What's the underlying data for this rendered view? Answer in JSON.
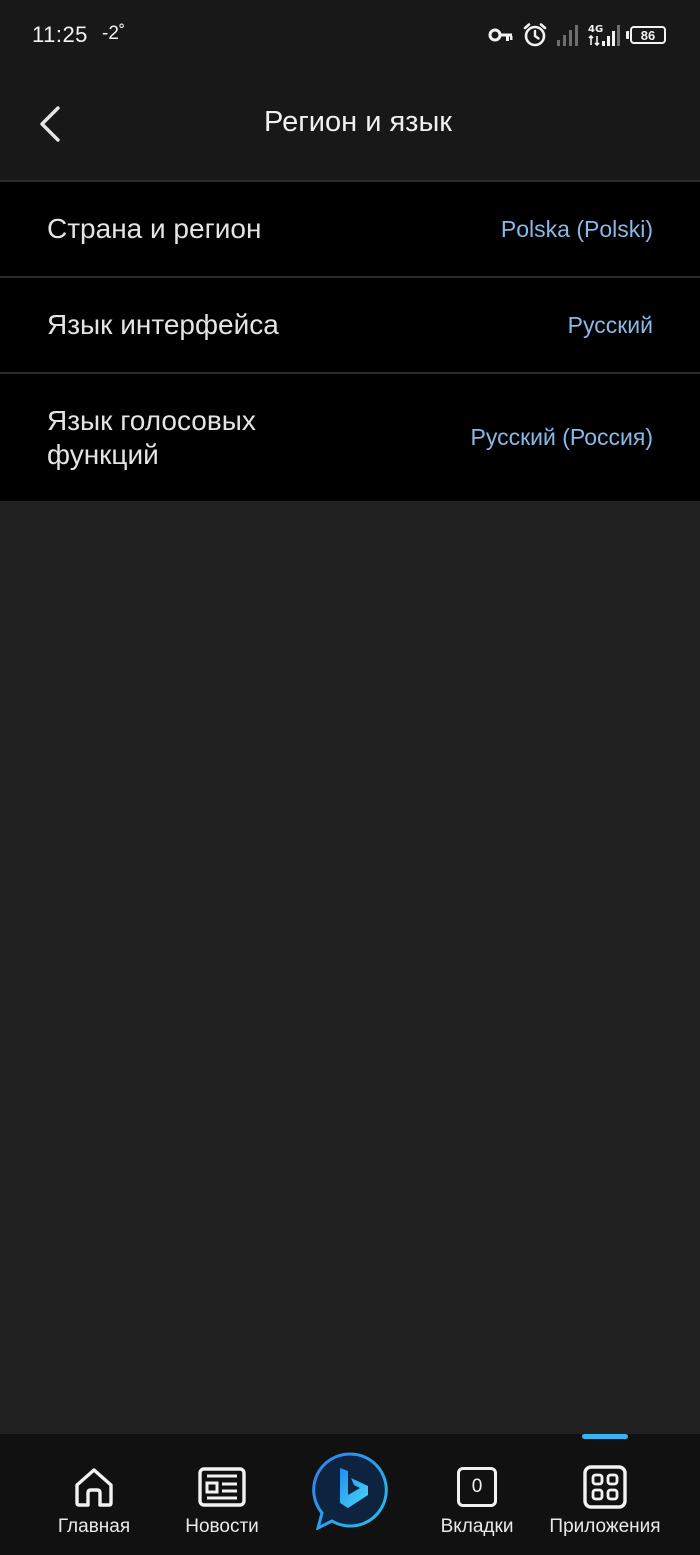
{
  "status_bar": {
    "time": "11:25",
    "temperature": "-2˚",
    "network_type": "4G",
    "battery_level": "86",
    "icons": [
      "key-icon",
      "alarm-icon",
      "signal-icon",
      "signal-4g-icon",
      "battery-icon"
    ]
  },
  "header": {
    "title": "Регион и язык",
    "back_icon": "chevron-left-icon"
  },
  "settings": [
    {
      "label": "Страна и регион",
      "value": "Polska (Polski)"
    },
    {
      "label": "Язык интерфейса",
      "value": "Русский"
    },
    {
      "label": "Язык голосовых функций",
      "value": "Русский (Россия)"
    }
  ],
  "bottom_nav": {
    "home": {
      "label": "Главная",
      "icon": "home-icon"
    },
    "news": {
      "label": "Новости",
      "icon": "newspaper-icon"
    },
    "bing": {
      "icon": "bing-chat-icon"
    },
    "tabs": {
      "label": "Вкладки",
      "count": "0",
      "icon": "tabs-icon"
    },
    "apps": {
      "label": "Приложения",
      "icon": "apps-grid-icon",
      "active": true
    }
  },
  "colors": {
    "background": "#212121",
    "list_background": "#000000",
    "header_background": "#181818",
    "value_text": "#8ab8e6",
    "accent": "#3ab4f0"
  }
}
